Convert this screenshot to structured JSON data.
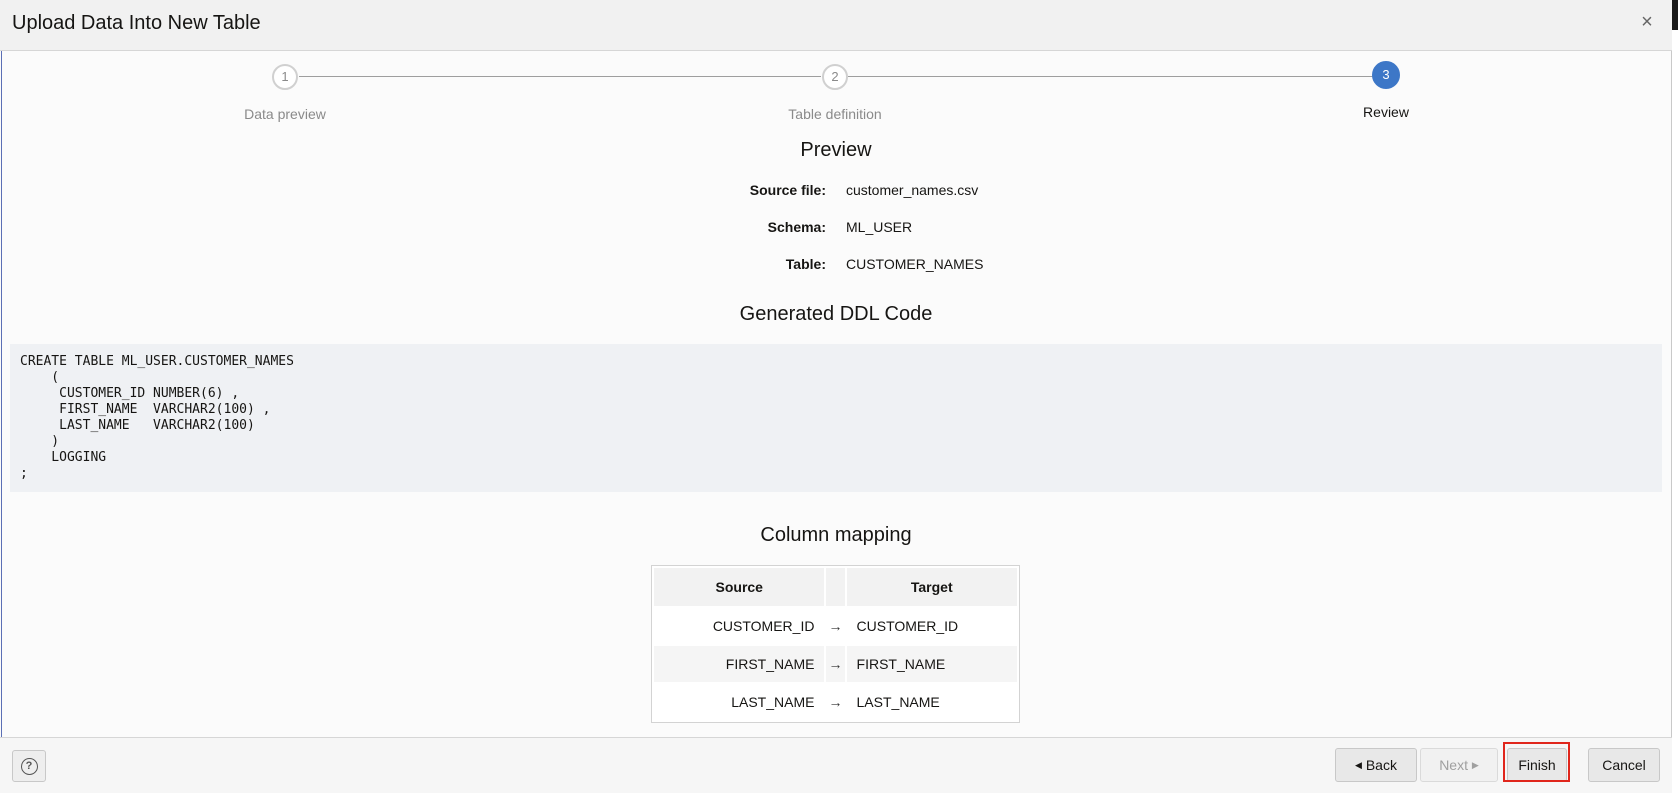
{
  "dialog": {
    "title": "Upload Data Into New Table",
    "close_icon": "×"
  },
  "stepper": {
    "steps": [
      {
        "number": "1",
        "label": "Data preview",
        "state": "complete"
      },
      {
        "number": "2",
        "label": "Table definition",
        "state": "complete"
      },
      {
        "number": "3",
        "label": "Review",
        "state": "active"
      }
    ],
    "active_color": "#3d77c7"
  },
  "preview": {
    "title": "Preview",
    "source_file_label": "Source file:",
    "source_file_value": "customer_names.csv",
    "schema_label": "Schema:",
    "schema_value": "ML_USER",
    "table_label": "Table:",
    "table_value": "CUSTOMER_NAMES"
  },
  "ddl": {
    "title": "Generated DDL Code",
    "code": "CREATE TABLE ML_USER.CUSTOMER_NAMES\n    (\n     CUSTOMER_ID NUMBER(6) ,\n     FIRST_NAME  VARCHAR2(100) ,\n     LAST_NAME   VARCHAR2(100)\n    )\n    LOGGING\n;"
  },
  "mapping": {
    "title": "Column mapping",
    "header_source": "Source",
    "header_target": "Target",
    "arrow": "→",
    "rows": [
      {
        "source": "CUSTOMER_ID",
        "target": "CUSTOMER_ID"
      },
      {
        "source": "FIRST_NAME",
        "target": "FIRST_NAME"
      },
      {
        "source": "LAST_NAME",
        "target": "LAST_NAME"
      }
    ]
  },
  "footer": {
    "help_icon": "?",
    "back_label": "Back",
    "next_label": "Next",
    "finish_label": "Finish",
    "cancel_label": "Cancel",
    "highlight_color": "#e0261c"
  }
}
